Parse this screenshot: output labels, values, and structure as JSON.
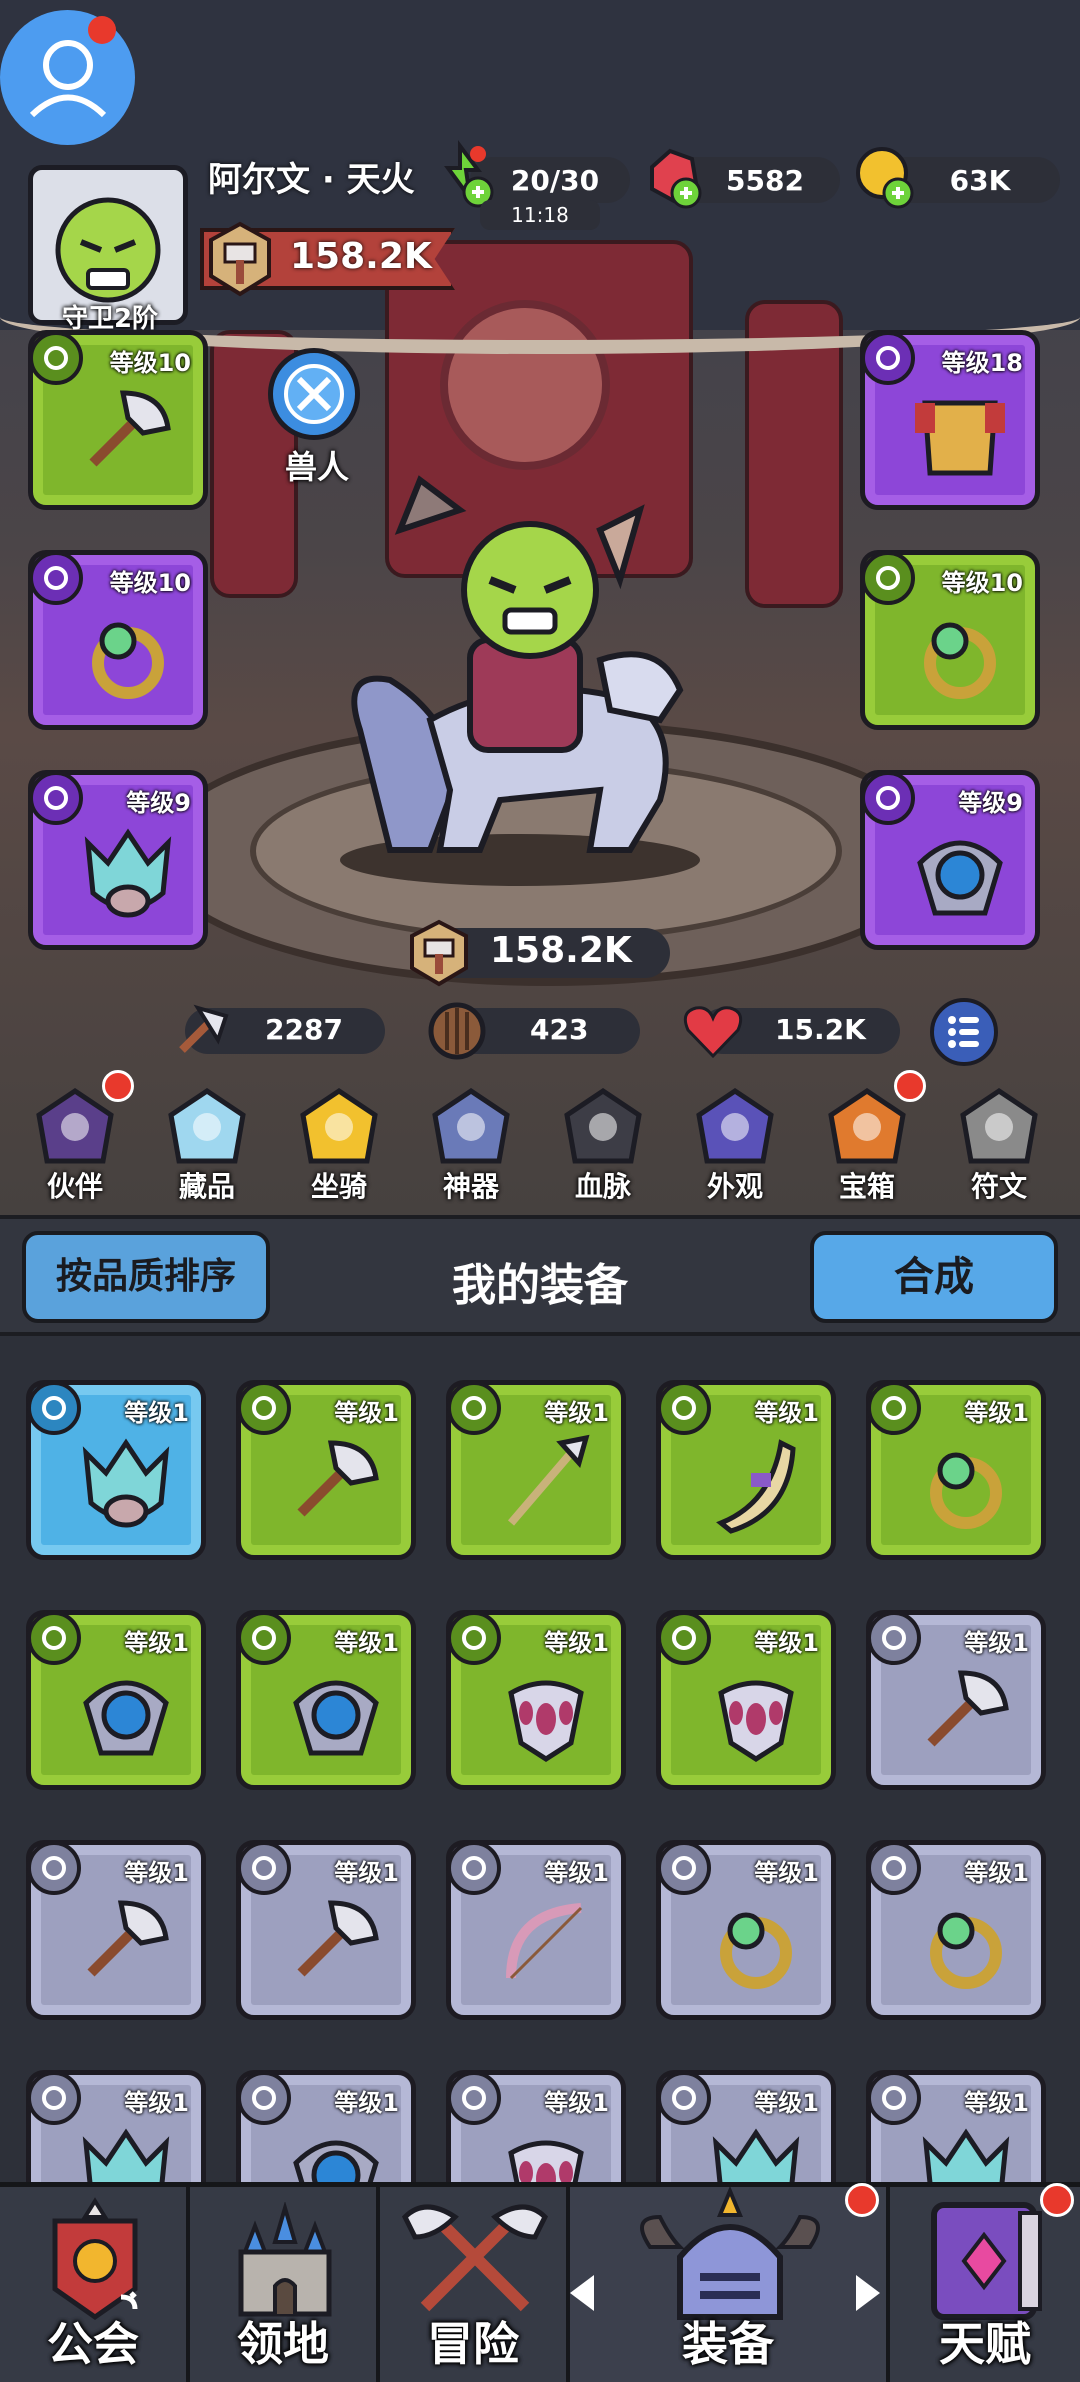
{
  "header": {
    "player_name": "阿尔文 · 天火",
    "rank_label": "守卫2阶",
    "power": "158.2K",
    "energy": "20/30",
    "energy_timer": "11:18",
    "gems": "5582",
    "gold": "63K"
  },
  "hero": {
    "race": "兽人",
    "power": "158.2K",
    "attack": "2287",
    "defense": "423",
    "health": "15.2K"
  },
  "equipped": [
    {
      "slot": "weapon",
      "level": "等级10",
      "rarity": "green",
      "icon": "axe-icon"
    },
    {
      "slot": "armor",
      "level": "等级18",
      "rarity": "purple",
      "icon": "armor-icon"
    },
    {
      "slot": "ring-left",
      "level": "等级10",
      "rarity": "purple",
      "icon": "ring-icon"
    },
    {
      "slot": "ring-right",
      "level": "等级10",
      "rarity": "green",
      "icon": "ring-icon"
    },
    {
      "slot": "helmet",
      "level": "等级9",
      "rarity": "purple",
      "icon": "helmet-icon"
    },
    {
      "slot": "amulet",
      "level": "等级9",
      "rarity": "purple",
      "icon": "amulet-icon"
    }
  ],
  "quick_menu": [
    {
      "label": "伙伴",
      "icon": "companion-icon",
      "dot": true
    },
    {
      "label": "藏品",
      "icon": "collection-icon",
      "dot": false
    },
    {
      "label": "坐骑",
      "icon": "mount-icon",
      "dot": false
    },
    {
      "label": "神器",
      "icon": "artifact-icon",
      "dot": false
    },
    {
      "label": "血脉",
      "icon": "bloodline-icon",
      "dot": false
    },
    {
      "label": "外观",
      "icon": "appearance-icon",
      "dot": false
    },
    {
      "label": "宝箱",
      "icon": "chest-icon",
      "dot": true
    },
    {
      "label": "符文",
      "icon": "rune-icon",
      "dot": false
    }
  ],
  "inventory_bar": {
    "sort_label": "按品质排序",
    "title": "我的装备",
    "merge_label": "合成"
  },
  "inventory": [
    {
      "level": "等级1",
      "rarity": "blue",
      "icon": "helmet-icon"
    },
    {
      "level": "等级1",
      "rarity": "green",
      "icon": "axe-icon"
    },
    {
      "level": "等级1",
      "rarity": "green",
      "icon": "spear-icon"
    },
    {
      "level": "等级1",
      "rarity": "green",
      "icon": "horn-icon"
    },
    {
      "level": "等级1",
      "rarity": "green",
      "icon": "ring-icon"
    },
    {
      "level": "等级1",
      "rarity": "green",
      "icon": "amulet-icon"
    },
    {
      "level": "等级1",
      "rarity": "green",
      "icon": "amulet-icon"
    },
    {
      "level": "等级1",
      "rarity": "green",
      "icon": "pendant-icon"
    },
    {
      "level": "等级1",
      "rarity": "green",
      "icon": "pendant-icon"
    },
    {
      "level": "等级1",
      "rarity": "gray",
      "icon": "axe-icon"
    },
    {
      "level": "等级1",
      "rarity": "gray",
      "icon": "axe-icon"
    },
    {
      "level": "等级1",
      "rarity": "gray",
      "icon": "axe-icon"
    },
    {
      "level": "等级1",
      "rarity": "gray",
      "icon": "bow-icon"
    },
    {
      "level": "等级1",
      "rarity": "gray",
      "icon": "ring-icon"
    },
    {
      "level": "等级1",
      "rarity": "gray",
      "icon": "ring-icon"
    },
    {
      "level": "等级1",
      "rarity": "gray",
      "icon": "helmet-icon"
    },
    {
      "level": "等级1",
      "rarity": "gray",
      "icon": "amulet-icon"
    },
    {
      "level": "等级1",
      "rarity": "gray",
      "icon": "pendant-icon"
    },
    {
      "level": "等级1",
      "rarity": "gray",
      "icon": "helmet-icon"
    },
    {
      "level": "等级1",
      "rarity": "gray",
      "icon": "helmet-icon"
    }
  ],
  "bottom_nav": [
    {
      "label": "公会",
      "icon": "guild-icon",
      "dot": false
    },
    {
      "label": "领地",
      "icon": "castle-icon",
      "dot": false
    },
    {
      "label": "冒险",
      "icon": "adventure-icon",
      "dot": false
    },
    {
      "label": "装备",
      "icon": "helmet-icon",
      "dot": true
    },
    {
      "label": "天赋",
      "icon": "talent-book-icon",
      "dot": true
    }
  ],
  "colors": {
    "green": "#7fb62c",
    "purple": "#8d46d8",
    "blue": "#4fb2e6",
    "gray": "#9da0bf",
    "red_dot": "#e8392c",
    "accent_button": "#57a8e8"
  }
}
